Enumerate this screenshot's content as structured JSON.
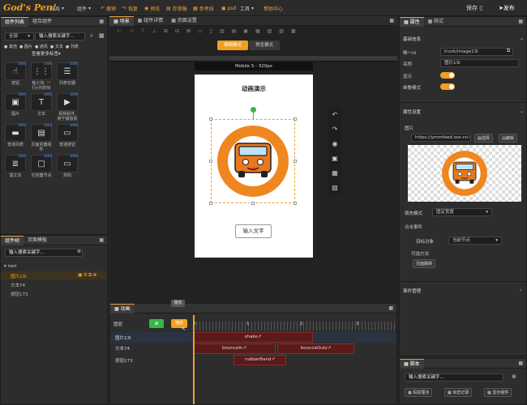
{
  "app": {
    "logo": "God's Pen!"
  },
  "menu": [
    {
      "label": "布局",
      "icon": "layout-icon"
    },
    {
      "label": "组件",
      "icon": "component-icon"
    },
    {
      "label": "撤销",
      "icon": "undo-icon"
    },
    {
      "label": "恢复",
      "icon": "redo-icon"
    },
    {
      "label": "预览",
      "icon": "eye-icon"
    },
    {
      "label": "存草稿",
      "icon": "draft-icon"
    },
    {
      "label": "参考线",
      "icon": "guide-icon"
    },
    {
      "label": "psd",
      "icon": "psd-icon"
    },
    {
      "label": "工具",
      "icon": "tool-icon"
    },
    {
      "label": "帮助中心",
      "icon": ""
    }
  ],
  "top_actions": {
    "save": "保存",
    "publish": "发布"
  },
  "left": {
    "tabs": [
      "组件列表",
      "组合组件"
    ],
    "filter_select": "全部",
    "search_placeholder": "输入搜索关键字...",
    "tags": [
      "其他",
      "图片",
      "通讯",
      "文本",
      "列表"
    ],
    "more_tags": "查看更多标签",
    "components": [
      {
        "label": "按钮",
        "glyph": "☝",
        "count": "1000"
      },
      {
        "label": "格子块, 一行n列的块",
        "glyph": "⋮⋮",
        "count": "1000"
      },
      {
        "label": "列表容器",
        "glyph": "☰",
        "count": "1000"
      },
      {
        "label": "",
        "glyph": "",
        "count": ""
      },
      {
        "label": "图片",
        "glyph": "▣",
        "count": "1000"
      },
      {
        "label": "文本",
        "glyph": "T",
        "count": "1000"
      },
      {
        "label": "视频组件, 用于播放视",
        "glyph": "▶",
        "count": "1000"
      },
      {
        "label": "",
        "glyph": "",
        "count": ""
      },
      {
        "label": "普通列表",
        "glyph": "▬",
        "count": "1000"
      },
      {
        "label": "页面容器组件",
        "glyph": "▤",
        "count": "1000"
      },
      {
        "label": "普通按钮",
        "glyph": "▭",
        "count": "1000"
      },
      {
        "label": "",
        "glyph": "",
        "count": ""
      },
      {
        "label": "富文本",
        "glyph": "≣",
        "count": "1000"
      },
      {
        "label": "空容器节点",
        "glyph": "□",
        "count": "1000"
      },
      {
        "label": "规则",
        "glyph": "▭",
        "count": "1000"
      },
      {
        "label": "",
        "glyph": "",
        "count": ""
      }
    ]
  },
  "tree": {
    "tabs": [
      "组件树",
      "页面模板"
    ],
    "search_placeholder": "输入搜索关键字...",
    "root": "root",
    "nodes": [
      "图片13I",
      "文本74",
      "按钮173"
    ]
  },
  "stage": {
    "tabs": [
      "场景",
      "组件详情",
      "页面设置"
    ],
    "modes": [
      "编辑模式",
      "预览模式"
    ],
    "device": "Mobile S - 320px",
    "title": "动画演示",
    "input_text": "输入文字"
  },
  "animation": {
    "tab": "动画",
    "tooltip": "播放",
    "layer_label": "图层",
    "ticks": [
      "0",
      "1",
      "2",
      "3"
    ],
    "rows": [
      {
        "name": "图片13I",
        "clips": [
          "shake"
        ]
      },
      {
        "name": "文本74",
        "clips": [
          "bounceIn",
          "bounceOutz"
        ]
      },
      {
        "name": "按钮173",
        "clips": [
          "rubberBand"
        ]
      }
    ]
  },
  "props": {
    "tabs": [
      "属性",
      "样式"
    ],
    "basic_title": "基础信息",
    "fields": [
      {
        "label": "唯一id",
        "value": "truck/image13I"
      },
      {
        "label": "名称",
        "value": "图片13I"
      }
    ],
    "show_label": "显示",
    "inherit_label": "继叠模式",
    "attr_title": "属性设置",
    "image_label": "图片",
    "image_url": "https://ymmfeed.oss-cn-han",
    "select_btn": "选择",
    "edit_btn": "编辑",
    "fill_label": "填充模式",
    "fill_value": "固定宽度",
    "click_label": "点击事件",
    "target_label": "目标对象",
    "target_value": "当前节点",
    "optional_label": "可选方法",
    "page_jump": "页面跳转",
    "event_label": "事件管理"
  },
  "script": {
    "tab": "脚本",
    "search_placeholder": "输入搜索关键字...",
    "buttons": [
      "码前埋点",
      "目击记录",
      "显示组件"
    ]
  },
  "colors": {
    "accent": "#f0a020",
    "clip": "#5a1a1a",
    "clip_border": "#8a2a2a"
  }
}
